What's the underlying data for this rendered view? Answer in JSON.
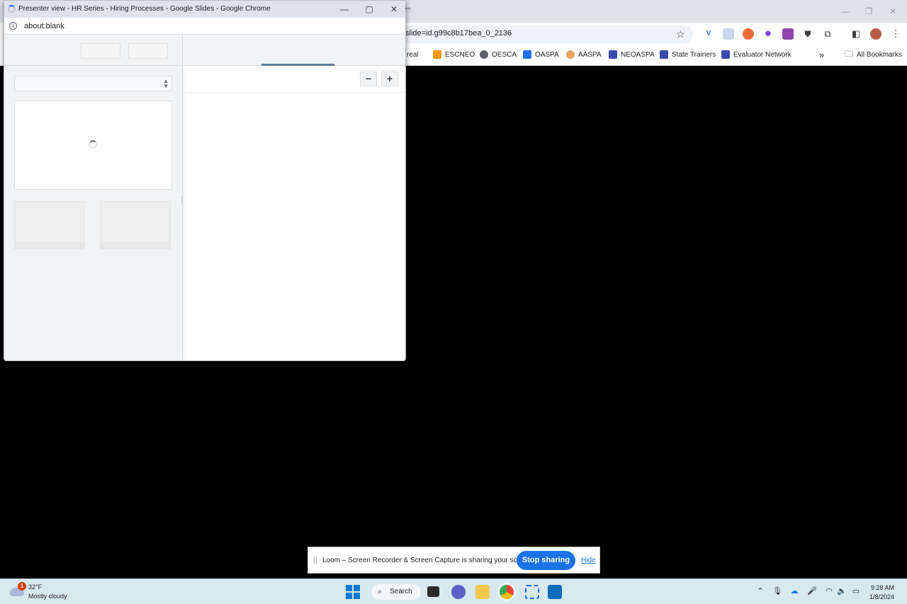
{
  "background_window": {
    "url_text": "slide=id.g99c8b17bea_0_2136",
    "bookmarks": [
      {
        "label": "real",
        "color": "#9aa0a6"
      },
      {
        "label": "ESCNEO",
        "color": "#f29900"
      },
      {
        "label": "OESCA",
        "color": "#5f6368"
      },
      {
        "label": "OASPA",
        "color": "#1a73e8"
      },
      {
        "label": "AASPA",
        "color": "#e8a25f"
      },
      {
        "label": "NEOASPA",
        "color": "#3949ab"
      },
      {
        "label": "State Trainers",
        "color": "#3949ab"
      },
      {
        "label": "Evaluator Network",
        "color": "#3949ab"
      }
    ],
    "all_bookmarks_label": "All Bookmarks",
    "more_bookmarks": "»"
  },
  "popup": {
    "title": "Presenter view - HR Series - Hiring Processes - Google Slides - Google Chrome",
    "address": "about:blank",
    "zoom_out_label": "−",
    "zoom_in_label": "+"
  },
  "loom": {
    "message": "Loom – Screen Recorder & Screen Capture is sharing your screen.",
    "stop_label": "Stop sharing",
    "hide_label": "Hide"
  },
  "taskbar": {
    "weather_badge": "1",
    "weather_temp": "32°F",
    "weather_desc": "Mostly cloudy",
    "search_label": "Search",
    "time": "9:28 AM",
    "date": "1/8/2024"
  },
  "colors": {
    "accent": "#1a73e8",
    "taskbar_bg": "#d6e9ef",
    "titlebar_bg": "#dee3ea"
  }
}
